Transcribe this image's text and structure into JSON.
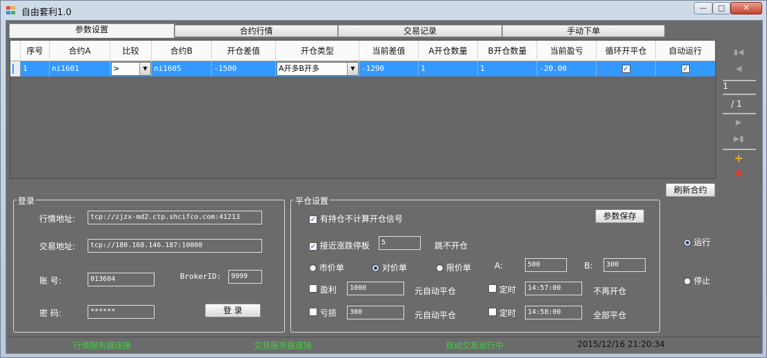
{
  "window": {
    "title": "自由套利1.0"
  },
  "tabs": [
    "参数设置",
    "合约行情",
    "交易记录",
    "手动下单"
  ],
  "grid": {
    "headers": [
      "序号",
      "合约A",
      "比较",
      "合约B",
      "开仓差值",
      "开仓类型",
      "当前差值",
      "A开仓数量",
      "B开仓数量",
      "当前盈亏",
      "循环开平仓",
      "自动运行"
    ],
    "rows": [
      {
        "index": "1",
        "contract_a": "ni1601",
        "compare": ">",
        "contract_b": "ni1605",
        "open_diff": "-1500",
        "open_type": "A开多B开多",
        "current_diff": "-1290",
        "qty_a": "1",
        "qty_b": "1",
        "pnl": "-20.00",
        "cycle": true,
        "auto": true
      }
    ]
  },
  "pager": {
    "current": "1",
    "total": "/ 1"
  },
  "buttons": {
    "refresh": "刷新合约",
    "save": "参数保存",
    "login": "登 录"
  },
  "login": {
    "title": "登录",
    "market_label": "行情地址:",
    "market_value": "tcp://zjzx-md2.ctp.shcifco.com:41213",
    "trade_label": "交易地址:",
    "trade_value": "tcp://180.168.146.187:10000",
    "account_label": "账    号:",
    "account_value": "013604",
    "broker_label": "BrokerID:",
    "broker_value": "9999",
    "password_label": "密    码:",
    "password_value": "******"
  },
  "settings": {
    "title": "平仓设置",
    "no_signal_label": "有持仓不计算开仓信号",
    "no_signal_checked": true,
    "limit_label": "接近涨跌停板",
    "limit_checked": true,
    "limit_value": "5",
    "limit_suffix": "跳不开仓",
    "order_types": [
      "市价单",
      "对价单",
      "限价单"
    ],
    "order_selected": 1,
    "a_label": "A:",
    "a_value": "500",
    "b_label": "B:",
    "b_value": "300",
    "profit_label": "盈利",
    "profit_value": "1000",
    "profit_suffix": "元自动平仓",
    "loss_label": "亏损",
    "loss_value": "300",
    "loss_suffix": "元自动平仓",
    "timer_label": "定时",
    "timer1_value": "14:57:00",
    "timer1_suffix": "不再开仓",
    "timer2_value": "14:58:00",
    "timer2_suffix": "全部平仓"
  },
  "run": {
    "run_label": "运行",
    "stop_label": "停止",
    "selected": "run"
  },
  "status": {
    "market": "行情服务器连接",
    "trade": "交易服务器连接",
    "auto": "自动交易运行中",
    "datetime": "2015/12/16 21:20:34"
  },
  "colors": {
    "selection": "#3399ff",
    "status_text": "#44c944",
    "panel_bg": "#6b6b6b"
  }
}
